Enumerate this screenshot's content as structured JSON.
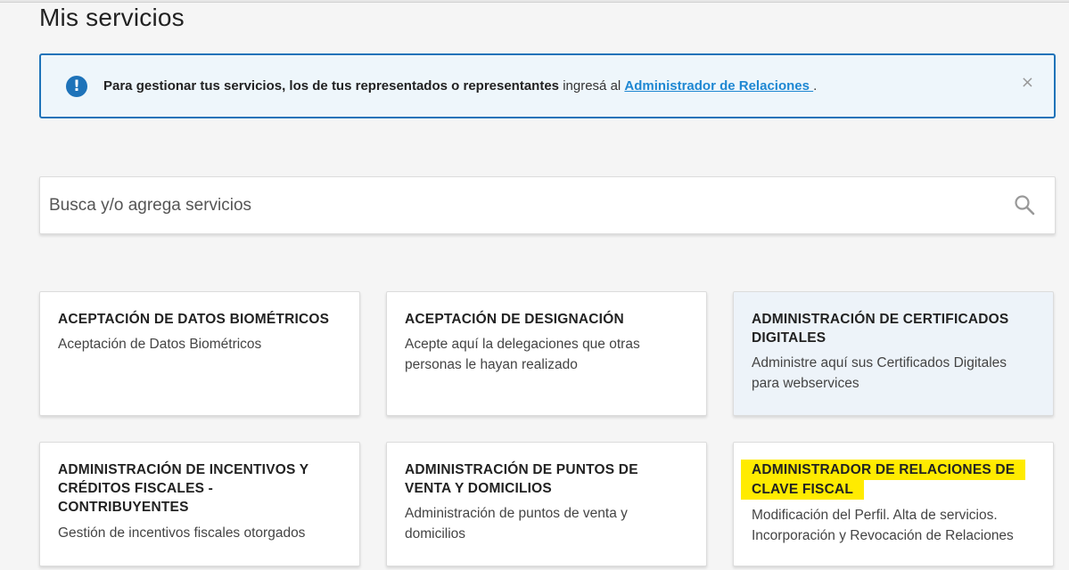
{
  "page": {
    "title": "Mis servicios"
  },
  "alert": {
    "icon": "exclamation-circle-icon",
    "text_bold": "Para gestionar tus servicios, los de tus representados o representantes",
    "text_plain": " ingresá al ",
    "link": "Administrador de Relaciones ",
    "text_end": ".",
    "close": "×"
  },
  "search": {
    "placeholder": "Busca y/o agrega servicios",
    "value": "",
    "icon": "search-icon"
  },
  "cards": [
    {
      "title": "ACEPTACIÓN DE DATOS BIOMÉTRICOS",
      "desc": "Aceptación de Datos Biométricos"
    },
    {
      "title": "ACEPTACIÓN DE DESIGNACIÓN",
      "desc": "Acepte aquí la delegaciones que otras personas le hayan realizado"
    },
    {
      "title": "ADMINISTRACIÓN DE CERTIFICADOS DIGITALES",
      "desc": "Administre aquí sus Certificados Digitales para webservices"
    },
    {
      "title": "ADMINISTRACIÓN DE INCENTIVOS Y CRÉDITOS FISCALES - CONTRIBUYENTES",
      "desc": "Gestión de incentivos fiscales otorgados"
    },
    {
      "title": "ADMINISTRACIÓN DE PUNTOS DE VENTA Y DOMICILIOS",
      "desc": "Administración de puntos de venta y domicilios"
    },
    {
      "title": "ADMINISTRADOR DE RELACIONES DE CLAVE FISCAL",
      "desc": "Modificación del Perfil. Alta de servicios. Incorporación y Revocación de Relaciones"
    }
  ],
  "colors": {
    "accent": "#1e73b9",
    "link": "#1e87d2",
    "highlight": "#ffeb00",
    "hover_card": "#edf3f9"
  }
}
